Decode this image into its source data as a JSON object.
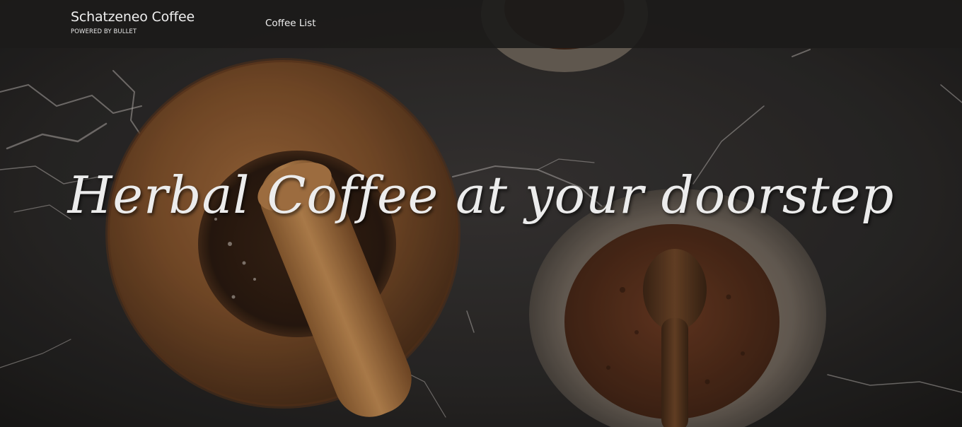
{
  "navbar": {
    "brand_title": "Schatzeneo Coffee",
    "brand_subtitle": "POWERED BY BULLET",
    "links": [
      {
        "label": "Coffee List"
      }
    ]
  },
  "hero": {
    "headline": "Herbal Coffee at your doorstep"
  },
  "colors": {
    "navbar_bg": "#1c1b1a",
    "text": "#ececec",
    "marble": "#2a2827",
    "wood": "#8a5a32",
    "coffee": "#4a2818"
  }
}
